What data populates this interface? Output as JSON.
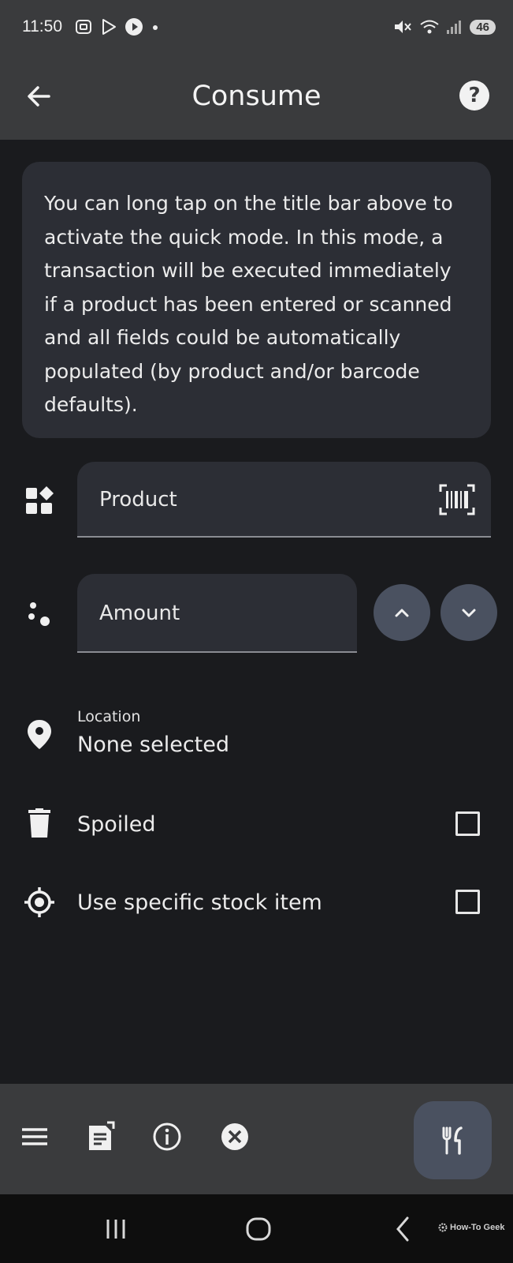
{
  "status": {
    "time": "11:50",
    "battery": "46"
  },
  "appbar": {
    "title": "Consume",
    "help": "?"
  },
  "info": {
    "text": "You can long tap on the title bar above to activate the quick mode. In this mode, a transaction will be executed immediately if a product has been entered or scanned and all fields could be automatically populated (by product and/or barcode defaults)."
  },
  "form": {
    "product_label": "Product",
    "amount_label": "Amount",
    "location_label": "Location",
    "location_value": "None selected",
    "spoiled_label": "Spoiled",
    "specific_stock_label": "Use specific stock item"
  },
  "watermark": "How-To Geek",
  "icons": {
    "back": "arrow-left-icon",
    "help": "help-circle-icon",
    "product": "category-icon",
    "barcode": "barcode-scan-icon",
    "amount": "scatter-dots-icon",
    "increase": "chevron-up-icon",
    "decrease": "chevron-down-icon",
    "location": "location-pin-icon",
    "spoiled": "trash-icon",
    "stock": "target-icon",
    "menu": "menu-icon",
    "doc": "document-icon",
    "info": "info-icon",
    "clear": "close-circle-icon",
    "consume": "utensils-icon"
  },
  "colors": {
    "background": "#1a1b1e",
    "surface": "#2c2e35",
    "bar": "#3a3b3d",
    "accent_button": "#4a5160"
  }
}
